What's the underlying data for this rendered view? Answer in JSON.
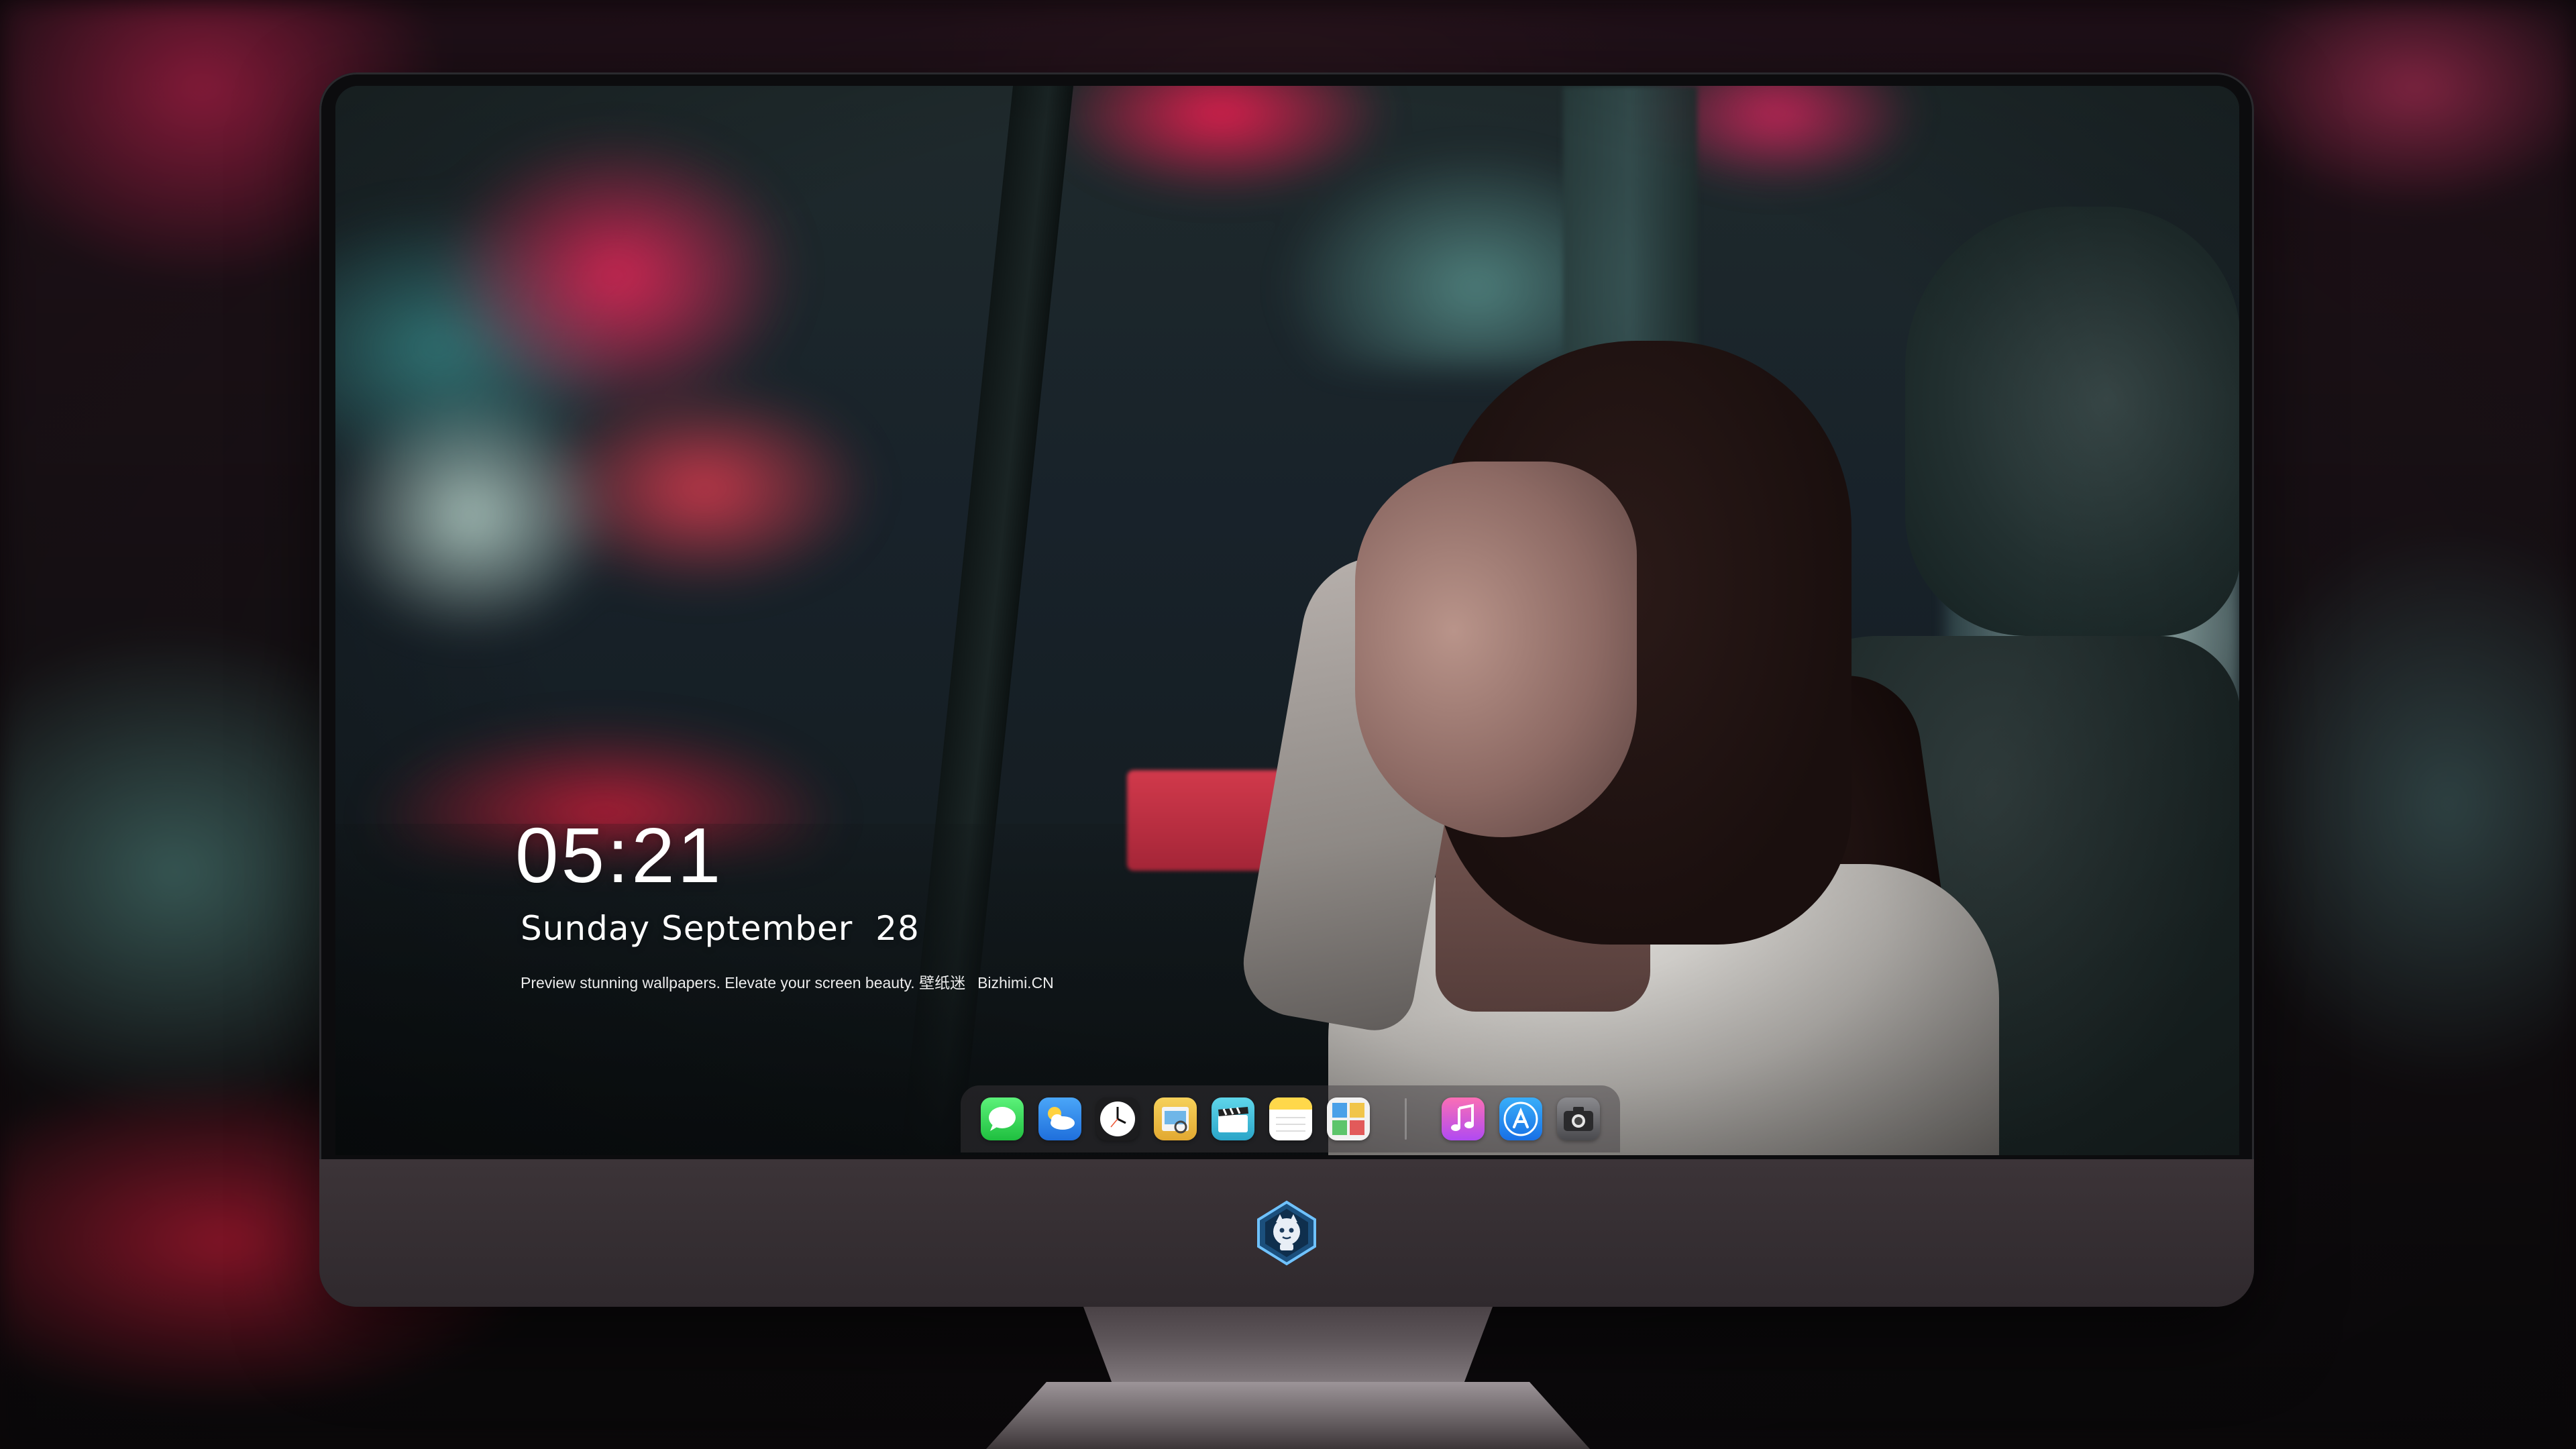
{
  "lock_screen": {
    "time": "05:21",
    "date": "Sunday September  28",
    "tagline": {
      "text": "Preview stunning wallpapers. Elevate your screen beauty.",
      "brand_cn": "壁纸迷",
      "brand_site": "Bizhimi.CN"
    }
  },
  "dock": {
    "apps": [
      {
        "name": "messages-icon",
        "color": "#34c759"
      },
      {
        "name": "weather-icon",
        "color": "#2f8cf0"
      },
      {
        "name": "clock-icon",
        "color": "#1c1c1e"
      },
      {
        "name": "preview-icon",
        "color": "#f5c84a"
      },
      {
        "name": "video-clapper-icon",
        "color": "#3fbfd8"
      },
      {
        "name": "notes-icon",
        "color": "#ffd84a"
      },
      {
        "name": "photo-booth-icon",
        "color": "#f2f2f2"
      }
    ],
    "pinned_apps": [
      {
        "name": "music-icon",
        "color": "#fc5aa9"
      },
      {
        "name": "app-store-icon",
        "color": "#1f8cf2"
      },
      {
        "name": "camera-icon",
        "color": "#5a5a5e"
      }
    ]
  },
  "colors": {
    "monitor_chin": "#3c3438",
    "dock_background": "rgba(60,55,60,0.45)"
  }
}
